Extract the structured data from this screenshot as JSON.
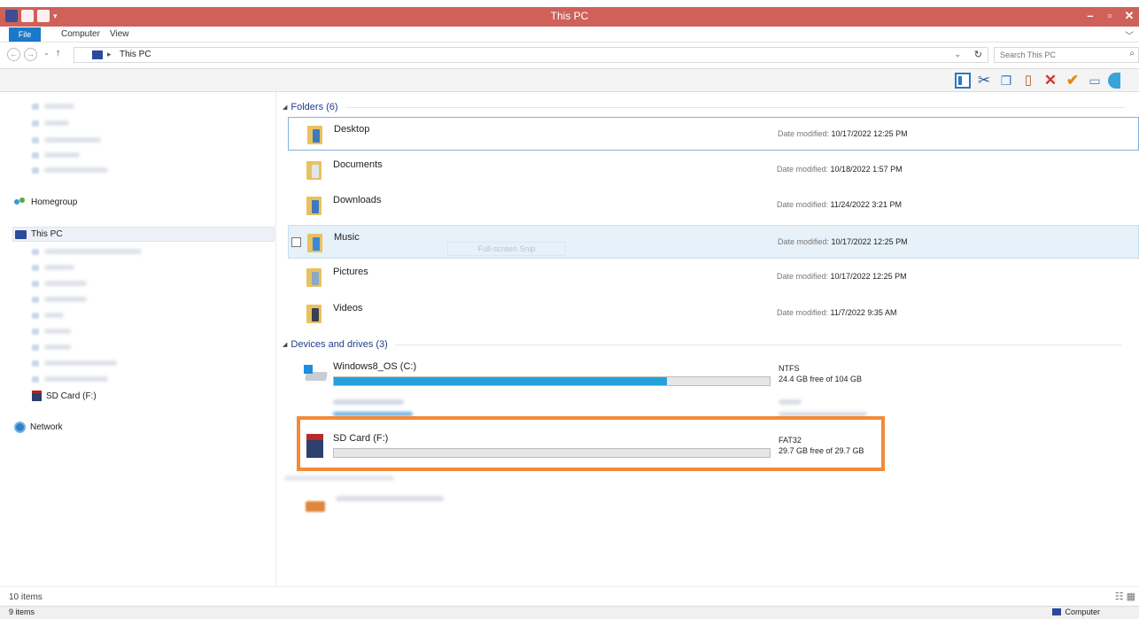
{
  "window": {
    "title": "This PC"
  },
  "ribbon": {
    "tabs": [
      "File",
      "Computer",
      "View"
    ]
  },
  "address": {
    "crumb": "This PC",
    "search_placeholder": "Search This PC"
  },
  "nav": {
    "homegroup": "Homegroup",
    "this_pc": "This PC",
    "sd_card": "SD Card (F:)",
    "network": "Network"
  },
  "folders_group": "Folders (6)",
  "folders": [
    {
      "name": "Desktop",
      "meta_label": "Date modified:",
      "date": "10/17/2022 12:25 PM"
    },
    {
      "name": "Documents",
      "meta_label": "Date modified:",
      "date": "10/18/2022 1:57 PM"
    },
    {
      "name": "Downloads",
      "meta_label": "Date modified:",
      "date": "11/24/2022 3:21 PM"
    },
    {
      "name": "Music",
      "meta_label": "Date modified:",
      "date": "10/17/2022 12:25 PM"
    },
    {
      "name": "Pictures",
      "meta_label": "Date modified:",
      "date": "10/17/2022 12:25 PM"
    },
    {
      "name": "Videos",
      "meta_label": "Date modified:",
      "date": "11/7/2022 9:35 AM"
    }
  ],
  "tooltip": "Full-screen Snip",
  "devices_group": "Devices and drives (3)",
  "drives": [
    {
      "name": "Windows8_OS (C:)",
      "fs": "NTFS",
      "free": "24.4 GB free of 104 GB",
      "used_fraction": 0.765
    },
    {
      "name": "SD Card (F:)",
      "fs": "FAT32",
      "free": "29.7 GB free of 29.7 GB",
      "used_fraction": 0.0
    }
  ],
  "status": {
    "items_top": "10 items",
    "items_bottom": "9 items",
    "zone": "Computer"
  },
  "colors": {
    "titlebar": "#d0605a",
    "file_tab": "#1979ca",
    "highlight": "#f28a3a",
    "drive_fill": "#26a0da"
  }
}
